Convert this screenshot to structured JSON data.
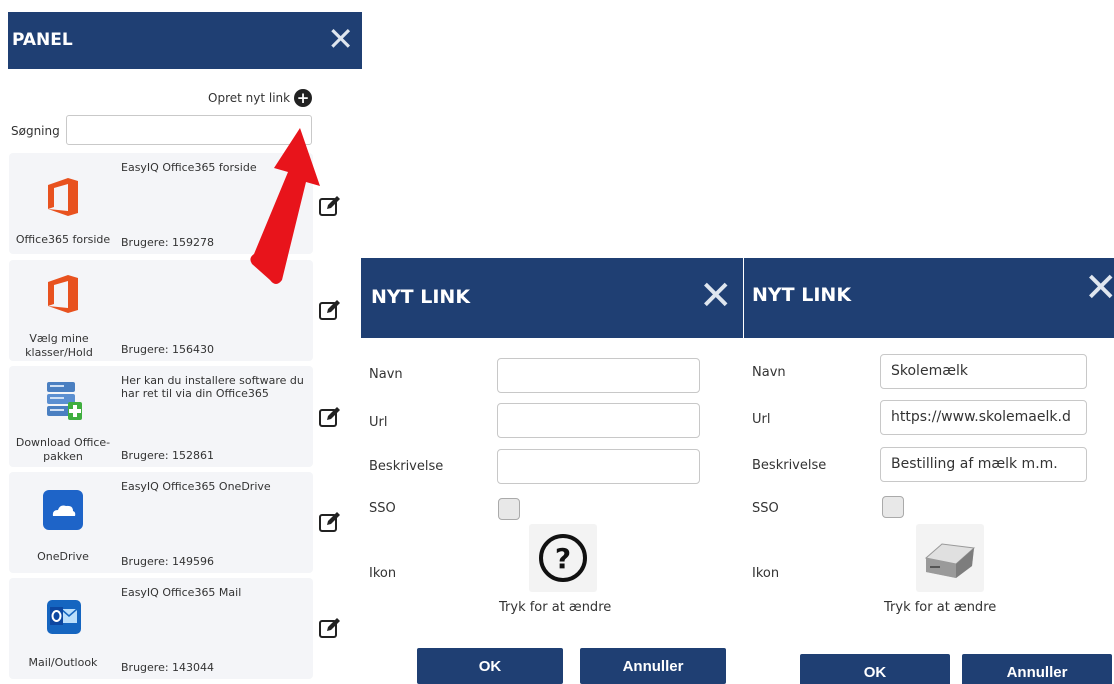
{
  "panel": {
    "title": "PANEL",
    "create_link_label": "Opret nyt link",
    "search_label": "Søgning",
    "search_value": "",
    "items": [
      {
        "name": "Office365 forside",
        "description": "EasyIQ Office365 forside",
        "users": "Brugere: 159278",
        "icon": "office-icon"
      },
      {
        "name": "Vælg mine klasser/Hold",
        "description": "",
        "users": "Brugere: 156430",
        "icon": "office-icon"
      },
      {
        "name": "Download Office-pakken",
        "description": "Her kan du installere software du har ret til via din Office365",
        "users": "Brugere: 152861",
        "icon": "server-add-icon"
      },
      {
        "name": "OneDrive",
        "description": "EasyIQ Office365 OneDrive",
        "users": "Brugere: 149596",
        "icon": "onedrive-icon"
      },
      {
        "name": "Mail/Outlook",
        "description": "EasyIQ Office365 Mail",
        "users": "Brugere: 143044",
        "icon": "outlook-icon"
      }
    ]
  },
  "dialog_empty": {
    "title": "NYT LINK",
    "labels": {
      "name": "Navn",
      "url": "Url",
      "description": "Beskrivelse",
      "sso": "SSO",
      "icon": "Ikon"
    },
    "values": {
      "name": "",
      "url": "",
      "description": ""
    },
    "sso_checked": false,
    "icon": "question-mark-icon",
    "change_icon_text": "Tryk for at ændre",
    "ok_label": "OK",
    "cancel_label": "Annuller"
  },
  "dialog_filled": {
    "title": "NYT LINK",
    "labels": {
      "name": "Navn",
      "url": "Url",
      "description": "Beskrivelse",
      "sso": "SSO",
      "icon": "Ikon"
    },
    "values": {
      "name": "Skolemælk",
      "url": "https://www.skolemaelk.d",
      "description": "Bestilling af mælk m.m."
    },
    "sso_checked": false,
    "icon": "hard-drive-icon",
    "change_icon_text": "Tryk for at ændre",
    "ok_label": "OK",
    "cancel_label": "Annuller"
  },
  "colors": {
    "header_bg": "#1f3f73",
    "button_bg": "#1f3f73",
    "card_bg": "#f4f5f8",
    "arrow": "#e8141b",
    "office_orange": "#e8521f",
    "onedrive_blue": "#1e64c8"
  }
}
